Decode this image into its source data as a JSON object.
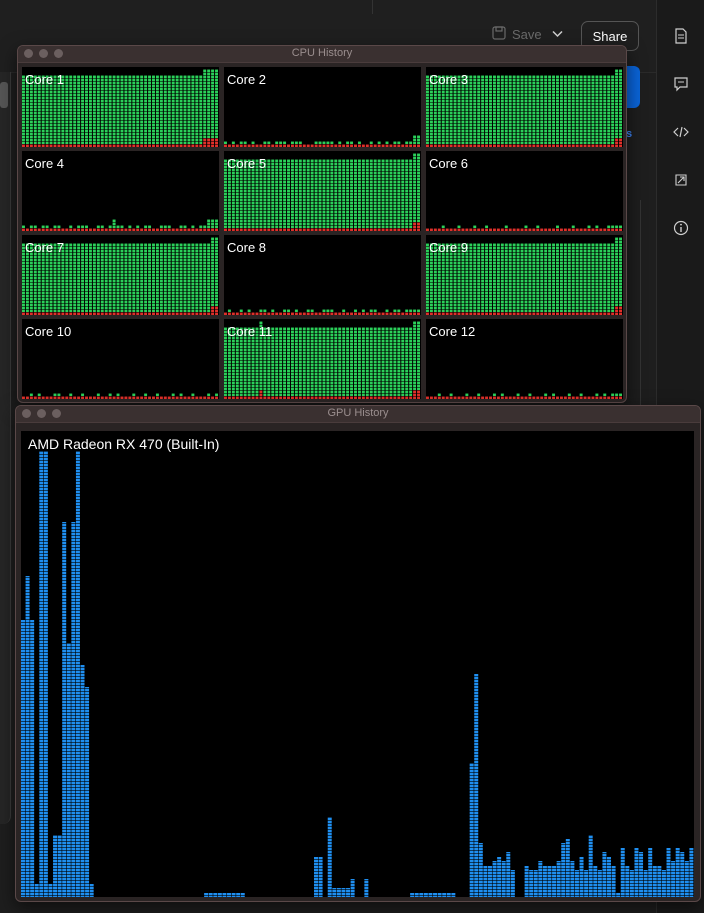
{
  "background": {
    "save_label": "Save",
    "share_label": "Share",
    "side_text": "s"
  },
  "colors": {
    "cpu_user": "#2bd05a",
    "cpu_system": "#e0302a",
    "gpu": "#1f8ff0"
  },
  "cpu_window": {
    "title": "CPU History",
    "cores": [
      {
        "label": "Core 1",
        "user": [
          88,
          88,
          88,
          88,
          88,
          88,
          88,
          88,
          88,
          88,
          88,
          88,
          88,
          88,
          88,
          88,
          88,
          88,
          88,
          88,
          88,
          88,
          88,
          88,
          88,
          88,
          88,
          88,
          88,
          88,
          88,
          88,
          88,
          88,
          88,
          88,
          88,
          88,
          88,
          88,
          88,
          88,
          88,
          88,
          88,
          88,
          88,
          88,
          88,
          88
        ],
        "system": [
          5,
          5,
          5,
          5,
          5,
          5,
          5,
          5,
          5,
          5,
          5,
          5,
          5,
          5,
          5,
          5,
          5,
          5,
          5,
          5,
          5,
          5,
          5,
          5,
          5,
          5,
          5,
          5,
          5,
          5,
          5,
          5,
          5,
          5,
          5,
          5,
          5,
          5,
          5,
          5,
          5,
          5,
          5,
          5,
          5,
          5,
          10,
          10,
          10,
          10
        ]
      },
      {
        "label": "Core 2",
        "user": [
          5,
          0,
          5,
          0,
          5,
          5,
          0,
          5,
          0,
          0,
          5,
          5,
          0,
          5,
          5,
          5,
          0,
          5,
          5,
          5,
          0,
          0,
          0,
          5,
          5,
          5,
          5,
          5,
          0,
          5,
          0,
          5,
          5,
          0,
          5,
          0,
          0,
          5,
          0,
          5,
          0,
          5,
          0,
          5,
          5,
          0,
          5,
          5,
          10,
          10
        ],
        "system": [
          5,
          5,
          5,
          5,
          5,
          5,
          5,
          5,
          5,
          5,
          5,
          5,
          5,
          5,
          5,
          5,
          5,
          5,
          5,
          5,
          5,
          5,
          5,
          5,
          5,
          5,
          5,
          5,
          5,
          5,
          5,
          5,
          5,
          5,
          5,
          5,
          5,
          5,
          5,
          5,
          5,
          5,
          5,
          5,
          5,
          5,
          5,
          5,
          5,
          5
        ]
      },
      {
        "label": "Core 3",
        "user": [
          90,
          90,
          90,
          90,
          90,
          90,
          90,
          90,
          90,
          90,
          90,
          90,
          90,
          90,
          90,
          90,
          90,
          90,
          90,
          90,
          90,
          90,
          90,
          90,
          90,
          90,
          90,
          90,
          90,
          90,
          90,
          90,
          90,
          90,
          90,
          90,
          90,
          90,
          90,
          90,
          90,
          90,
          90,
          90,
          90,
          90,
          90,
          90,
          90,
          90
        ],
        "system": [
          5,
          5,
          5,
          5,
          5,
          5,
          5,
          5,
          5,
          5,
          5,
          5,
          5,
          5,
          5,
          5,
          5,
          5,
          5,
          5,
          5,
          5,
          5,
          5,
          5,
          5,
          5,
          5,
          5,
          5,
          5,
          5,
          5,
          5,
          5,
          5,
          5,
          5,
          5,
          5,
          5,
          5,
          5,
          5,
          5,
          5,
          5,
          5,
          10,
          10
        ]
      },
      {
        "label": "Core 4",
        "user": [
          5,
          0,
          5,
          5,
          0,
          5,
          5,
          0,
          5,
          5,
          0,
          0,
          5,
          0,
          5,
          5,
          5,
          0,
          0,
          5,
          5,
          0,
          5,
          10,
          5,
          5,
          0,
          5,
          0,
          5,
          0,
          5,
          5,
          0,
          0,
          5,
          5,
          5,
          0,
          0,
          5,
          5,
          0,
          5,
          0,
          5,
          5,
          10,
          10,
          10
        ],
        "system": [
          5,
          5,
          5,
          5,
          5,
          5,
          5,
          5,
          5,
          5,
          5,
          5,
          5,
          5,
          5,
          5,
          5,
          5,
          5,
          5,
          5,
          5,
          5,
          5,
          5,
          5,
          5,
          5,
          5,
          5,
          5,
          5,
          5,
          5,
          5,
          5,
          5,
          5,
          5,
          5,
          5,
          5,
          5,
          5,
          5,
          5,
          5,
          5,
          5,
          5
        ]
      },
      {
        "label": "Core 5",
        "user": [
          88,
          88,
          88,
          88,
          88,
          88,
          88,
          88,
          88,
          88,
          88,
          88,
          88,
          88,
          88,
          88,
          88,
          88,
          88,
          88,
          88,
          88,
          88,
          88,
          88,
          88,
          88,
          88,
          88,
          88,
          88,
          88,
          88,
          88,
          88,
          88,
          88,
          88,
          88,
          88,
          88,
          88,
          88,
          88,
          88,
          88,
          88,
          88,
          88,
          88
        ],
        "system": [
          5,
          5,
          5,
          5,
          5,
          5,
          5,
          5,
          5,
          5,
          5,
          5,
          5,
          5,
          5,
          5,
          5,
          5,
          5,
          5,
          5,
          5,
          5,
          5,
          5,
          5,
          5,
          5,
          5,
          5,
          5,
          5,
          5,
          5,
          5,
          5,
          5,
          5,
          5,
          5,
          5,
          5,
          5,
          5,
          5,
          5,
          5,
          5,
          10,
          10
        ]
      },
      {
        "label": "Core 6",
        "user": [
          0,
          0,
          0,
          0,
          5,
          0,
          0,
          0,
          5,
          0,
          0,
          0,
          5,
          0,
          0,
          5,
          0,
          0,
          0,
          0,
          5,
          0,
          0,
          0,
          0,
          5,
          0,
          0,
          5,
          0,
          0,
          0,
          0,
          5,
          0,
          0,
          0,
          5,
          0,
          0,
          0,
          5,
          0,
          5,
          0,
          0,
          5,
          5,
          5,
          5
        ],
        "system": [
          5,
          5,
          5,
          5,
          5,
          5,
          5,
          5,
          5,
          5,
          5,
          5,
          5,
          5,
          5,
          5,
          5,
          5,
          5,
          5,
          5,
          5,
          5,
          5,
          5,
          5,
          5,
          5,
          5,
          5,
          5,
          5,
          5,
          5,
          5,
          5,
          5,
          5,
          5,
          5,
          5,
          5,
          5,
          5,
          5,
          5,
          5,
          5,
          5,
          5
        ]
      },
      {
        "label": "Core 7",
        "user": [
          88,
          88,
          88,
          88,
          88,
          88,
          88,
          88,
          88,
          88,
          88,
          88,
          88,
          88,
          88,
          88,
          88,
          88,
          88,
          88,
          88,
          88,
          88,
          88,
          88,
          88,
          88,
          88,
          88,
          88,
          88,
          88,
          88,
          88,
          88,
          88,
          88,
          88,
          88,
          88,
          88,
          88,
          88,
          88,
          88,
          88,
          88,
          88,
          88,
          88
        ],
        "system": [
          5,
          5,
          5,
          5,
          5,
          5,
          5,
          5,
          5,
          5,
          5,
          5,
          5,
          5,
          5,
          5,
          5,
          5,
          5,
          5,
          5,
          5,
          5,
          5,
          5,
          5,
          5,
          5,
          5,
          5,
          5,
          5,
          5,
          5,
          5,
          5,
          5,
          5,
          5,
          5,
          5,
          5,
          5,
          5,
          5,
          5,
          5,
          5,
          10,
          10
        ]
      },
      {
        "label": "Core 8",
        "user": [
          0,
          5,
          0,
          0,
          5,
          0,
          5,
          0,
          0,
          5,
          5,
          0,
          5,
          0,
          0,
          5,
          5,
          0,
          5,
          0,
          0,
          5,
          5,
          0,
          0,
          5,
          5,
          5,
          0,
          0,
          5,
          0,
          0,
          5,
          0,
          5,
          0,
          5,
          5,
          0,
          0,
          5,
          0,
          5,
          5,
          0,
          5,
          5,
          5,
          5
        ],
        "system": [
          5,
          5,
          5,
          5,
          5,
          5,
          5,
          5,
          5,
          5,
          5,
          5,
          5,
          5,
          5,
          5,
          5,
          5,
          5,
          5,
          5,
          5,
          5,
          5,
          5,
          5,
          5,
          5,
          5,
          5,
          5,
          5,
          5,
          5,
          5,
          5,
          5,
          5,
          5,
          5,
          5,
          5,
          5,
          5,
          5,
          5,
          5,
          5,
          5,
          5
        ]
      },
      {
        "label": "Core 9",
        "user": [
          88,
          88,
          88,
          88,
          88,
          88,
          88,
          88,
          88,
          88,
          88,
          88,
          88,
          88,
          88,
          88,
          88,
          88,
          88,
          88,
          88,
          88,
          88,
          88,
          88,
          88,
          88,
          88,
          88,
          88,
          88,
          88,
          88,
          88,
          88,
          88,
          88,
          88,
          88,
          88,
          88,
          88,
          88,
          88,
          88,
          88,
          88,
          88,
          88,
          88
        ],
        "system": [
          5,
          5,
          5,
          5,
          5,
          5,
          5,
          5,
          5,
          5,
          5,
          5,
          5,
          5,
          5,
          5,
          5,
          5,
          5,
          5,
          5,
          5,
          5,
          5,
          5,
          5,
          5,
          5,
          5,
          5,
          5,
          5,
          5,
          5,
          5,
          5,
          5,
          5,
          5,
          5,
          5,
          5,
          5,
          5,
          5,
          5,
          5,
          5,
          10,
          10
        ]
      },
      {
        "label": "Core 10",
        "user": [
          0,
          0,
          5,
          0,
          5,
          0,
          0,
          0,
          5,
          5,
          0,
          0,
          5,
          0,
          0,
          5,
          0,
          0,
          0,
          5,
          0,
          0,
          5,
          0,
          5,
          0,
          0,
          0,
          5,
          0,
          0,
          5,
          0,
          0,
          5,
          0,
          0,
          0,
          5,
          0,
          5,
          0,
          0,
          5,
          0,
          0,
          0,
          5,
          0,
          5
        ],
        "system": [
          5,
          5,
          5,
          5,
          5,
          5,
          5,
          5,
          5,
          5,
          5,
          5,
          5,
          5,
          5,
          5,
          5,
          5,
          5,
          5,
          5,
          5,
          5,
          5,
          5,
          5,
          5,
          5,
          5,
          5,
          5,
          5,
          5,
          5,
          5,
          5,
          5,
          5,
          5,
          5,
          5,
          5,
          5,
          5,
          5,
          5,
          5,
          5,
          5,
          5
        ]
      },
      {
        "label": "Core 11",
        "user": [
          88,
          88,
          88,
          88,
          88,
          88,
          88,
          88,
          88,
          88,
          88,
          88,
          88,
          88,
          88,
          88,
          88,
          88,
          88,
          88,
          88,
          88,
          88,
          88,
          88,
          88,
          88,
          88,
          88,
          88,
          88,
          88,
          88,
          88,
          88,
          88,
          88,
          88,
          88,
          88,
          88,
          88,
          88,
          88,
          88,
          88,
          88,
          88,
          88,
          88
        ],
        "system": [
          5,
          5,
          5,
          5,
          5,
          5,
          5,
          5,
          5,
          10,
          5,
          5,
          5,
          5,
          5,
          5,
          5,
          5,
          5,
          5,
          5,
          5,
          5,
          5,
          5,
          5,
          5,
          5,
          5,
          5,
          5,
          5,
          5,
          5,
          5,
          5,
          5,
          5,
          5,
          5,
          5,
          5,
          5,
          5,
          5,
          5,
          5,
          5,
          10,
          10
        ]
      },
      {
        "label": "Core 12",
        "user": [
          0,
          0,
          0,
          5,
          0,
          0,
          5,
          0,
          0,
          0,
          5,
          0,
          0,
          5,
          0,
          0,
          0,
          5,
          0,
          5,
          0,
          0,
          0,
          5,
          0,
          0,
          5,
          0,
          0,
          0,
          5,
          0,
          5,
          0,
          0,
          0,
          5,
          0,
          0,
          5,
          0,
          0,
          0,
          5,
          0,
          5,
          0,
          5,
          5,
          5
        ],
        "system": [
          5,
          5,
          5,
          5,
          5,
          5,
          5,
          5,
          5,
          5,
          5,
          5,
          5,
          5,
          5,
          5,
          5,
          5,
          5,
          5,
          5,
          5,
          5,
          5,
          5,
          5,
          5,
          5,
          5,
          5,
          5,
          5,
          5,
          5,
          5,
          5,
          5,
          5,
          5,
          5,
          5,
          5,
          5,
          5,
          5,
          5,
          5,
          5,
          5,
          5
        ]
      }
    ]
  },
  "gpu_window": {
    "title": "GPU History",
    "device_label": "AMD Radeon RX 470 (Built-In)",
    "usage": [
      62,
      72,
      62,
      3,
      100,
      100,
      3,
      14,
      14,
      84,
      57,
      84,
      100,
      52,
      47,
      3,
      0,
      0,
      0,
      0,
      0,
      0,
      0,
      0,
      0,
      0,
      0,
      0,
      0,
      0,
      0,
      0,
      0,
      0,
      0,
      0,
      0,
      0,
      0,
      0,
      1,
      1,
      1,
      1,
      1,
      1,
      1,
      1,
      1,
      0,
      0,
      0,
      0,
      0,
      0,
      0,
      0,
      0,
      0,
      0,
      0,
      0,
      0,
      0,
      9,
      9,
      0,
      18,
      2,
      2,
      2,
      2,
      4,
      0,
      0,
      4,
      0,
      0,
      0,
      0,
      0,
      0,
      0,
      0,
      0,
      1,
      1,
      1,
      1,
      1,
      1,
      1,
      1,
      1,
      1,
      0,
      0,
      0,
      30,
      50,
      12,
      7,
      7,
      8,
      9,
      8,
      10,
      6,
      0,
      0,
      7,
      6,
      6,
      8,
      7,
      7,
      7,
      8,
      12,
      13,
      8,
      6,
      9,
      6,
      14,
      7,
      6,
      10,
      9,
      7,
      1,
      11,
      7,
      6,
      11,
      10,
      6,
      11,
      7,
      7,
      6,
      11,
      8,
      11,
      10,
      8,
      11
    ]
  }
}
